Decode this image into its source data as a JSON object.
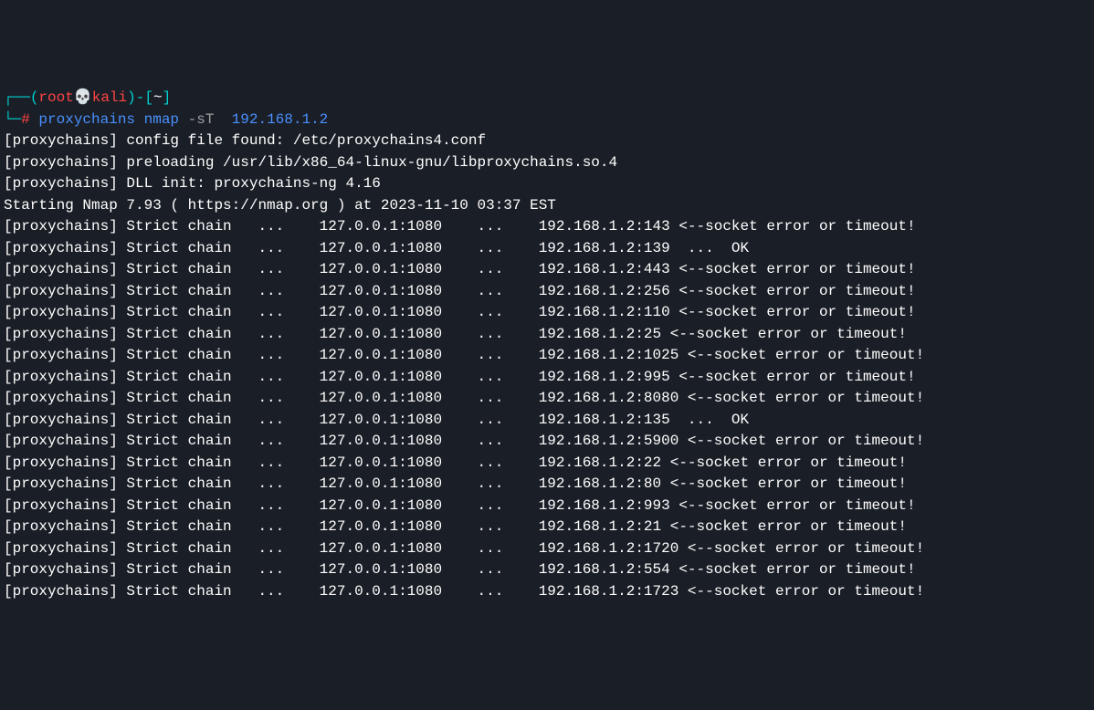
{
  "prompt": {
    "open_paren": "(",
    "user": "root",
    "skull": "💀",
    "host": "kali",
    "close_paren": ")",
    "dash": "-",
    "bracket_open": "[",
    "tilde": "~",
    "bracket_close": "]",
    "hash": "#",
    "command1": "proxychains",
    "command2": "nmap",
    "flag": "-sT",
    "target": "192.168.1.2"
  },
  "lines": [
    {
      "text": "[proxychains] config file found: /etc/proxychains4.conf"
    },
    {
      "text": "[proxychains] preloading /usr/lib/x86_64-linux-gnu/libproxychains.so.4"
    },
    {
      "text": "[proxychains] DLL init: proxychains-ng 4.16"
    },
    {
      "text": "Starting Nmap 7.93 ( https://nmap.org ) at 2023-11-10 03:37 EST"
    }
  ],
  "chains": [
    {
      "proxy": "127.0.0.1:1080",
      "dest": "192.168.1.2:143",
      "status": "<--socket error or timeout!"
    },
    {
      "proxy": "127.0.0.1:1080",
      "dest": "192.168.1.2:139",
      "status": " ...  OK"
    },
    {
      "proxy": "127.0.0.1:1080",
      "dest": "192.168.1.2:443",
      "status": "<--socket error or timeout!"
    },
    {
      "proxy": "127.0.0.1:1080",
      "dest": "192.168.1.2:256",
      "status": "<--socket error or timeout!"
    },
    {
      "proxy": "127.0.0.1:1080",
      "dest": "192.168.1.2:110",
      "status": "<--socket error or timeout!"
    },
    {
      "proxy": "127.0.0.1:1080",
      "dest": "192.168.1.2:25",
      "status": "<--socket error or timeout!"
    },
    {
      "proxy": "127.0.0.1:1080",
      "dest": "192.168.1.2:1025",
      "status": "<--socket error or timeout!"
    },
    {
      "proxy": "127.0.0.1:1080",
      "dest": "192.168.1.2:995",
      "status": "<--socket error or timeout!"
    },
    {
      "proxy": "127.0.0.1:1080",
      "dest": "192.168.1.2:8080",
      "status": "<--socket error or timeout!"
    },
    {
      "proxy": "127.0.0.1:1080",
      "dest": "192.168.1.2:135",
      "status": " ...  OK"
    },
    {
      "proxy": "127.0.0.1:1080",
      "dest": "192.168.1.2:5900",
      "status": "<--socket error or timeout!"
    },
    {
      "proxy": "127.0.0.1:1080",
      "dest": "192.168.1.2:22",
      "status": "<--socket error or timeout!"
    },
    {
      "proxy": "127.0.0.1:1080",
      "dest": "192.168.1.2:80",
      "status": "<--socket error or timeout!"
    },
    {
      "proxy": "127.0.0.1:1080",
      "dest": "192.168.1.2:993",
      "status": "<--socket error or timeout!"
    },
    {
      "proxy": "127.0.0.1:1080",
      "dest": "192.168.1.2:21",
      "status": "<--socket error or timeout!"
    },
    {
      "proxy": "127.0.0.1:1080",
      "dest": "192.168.1.2:1720",
      "status": "<--socket error or timeout!"
    },
    {
      "proxy": "127.0.0.1:1080",
      "dest": "192.168.1.2:554",
      "status": "<--socket error or timeout!"
    },
    {
      "proxy": "127.0.0.1:1080",
      "dest": "192.168.1.2:1723",
      "status": "<--socket error or timeout!"
    }
  ],
  "chain_prefix": "[proxychains] Strict chain",
  "ellipsis": "..."
}
